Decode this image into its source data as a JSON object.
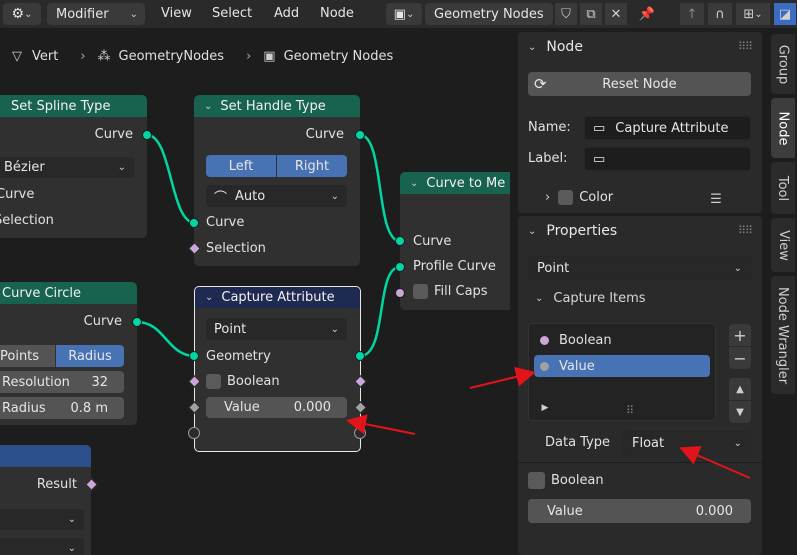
{
  "header": {
    "editor_menu": "Modifier",
    "menus": [
      "View",
      "Select",
      "Add",
      "Node"
    ],
    "tree_name": "Geometry Nodes"
  },
  "breadcrumb": [
    "Vert",
    "GeometryNodes",
    "Geometry Nodes"
  ],
  "nodes": {
    "set_spline_type": {
      "title": "Set Spline Type",
      "out_curve": "Curve",
      "mode": "Bézier",
      "in_curve": "Curve",
      "in_selection": "Selection"
    },
    "set_handle_type": {
      "title": "Set Handle Type",
      "out_curve": "Curve",
      "left": "Left",
      "right": "Right",
      "mode": "Auto",
      "in_curve": "Curve",
      "in_selection": "Selection"
    },
    "curve_circle": {
      "title": "Curve Circle",
      "out_curve": "Curve",
      "points": "Points",
      "radius_tab": "Radius",
      "resolution_label": "Resolution",
      "resolution_value": "32",
      "radius_label": "Radius",
      "radius_value": "0.8 m"
    },
    "capture_attribute": {
      "title": "Capture Attribute",
      "domain": "Point",
      "geometry": "Geometry",
      "boolean": "Boolean",
      "value_label": "Value",
      "value": "0.000"
    },
    "curve_to_mesh": {
      "title": "Curve to Me",
      "curve": "Curve",
      "profile_curve": "Profile Curve",
      "fill_caps": "Fill Caps"
    },
    "bottom_node": {
      "result": "Result"
    }
  },
  "sidebar": {
    "node_section": {
      "title": "Node",
      "reset": "Reset Node",
      "name_label": "Name:",
      "name_value": "Capture Attribute",
      "label_label": "Label:",
      "label_value": "",
      "color": "Color"
    },
    "properties_section": {
      "title": "Properties",
      "domain": "Point",
      "capture_items_title": "Capture Items",
      "items": [
        "Boolean",
        "Value"
      ],
      "data_type_label": "Data Type",
      "data_type_value": "Float",
      "boolean": "Boolean",
      "value_label": "Value",
      "value": "0.000"
    },
    "tabs": [
      "Group",
      "Node",
      "Tool",
      "View",
      "Node Wrangler"
    ]
  },
  "colors": {
    "accent": "#4772b3",
    "node_header_green": "#17634f",
    "node_header_navy": "#1e2a52",
    "socket_green": "#00d6a3",
    "socket_pink": "#cca6d6",
    "annotation_red": "#e1141c"
  }
}
